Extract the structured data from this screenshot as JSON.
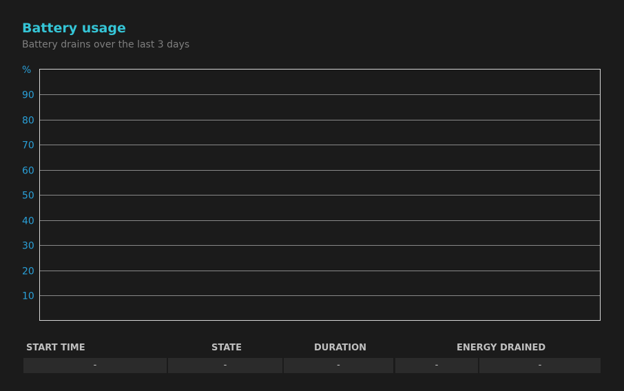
{
  "header": {
    "title": "Battery usage",
    "subtitle": "Battery drains over the last 3 days"
  },
  "colors": {
    "background": "#1b1b1b",
    "accent": "#35c5d6",
    "axis_label": "#2aa0d8",
    "grid": "#8a8a8a",
    "frame": "#d8d8d8"
  },
  "chart_data": {
    "type": "line",
    "title": "Battery usage",
    "subtitle": "Battery drains over the last 3 days",
    "ylabel": "%",
    "ylim": [
      0,
      100
    ],
    "y_ticks": [
      90,
      80,
      70,
      60,
      50,
      40,
      30,
      20,
      10
    ],
    "grid": true,
    "series": []
  },
  "table": {
    "columns": [
      "START TIME",
      "STATE",
      "DURATION",
      "ENERGY DRAINED"
    ],
    "rows": [
      [
        "-",
        "-",
        "-",
        "-",
        "-"
      ]
    ]
  }
}
